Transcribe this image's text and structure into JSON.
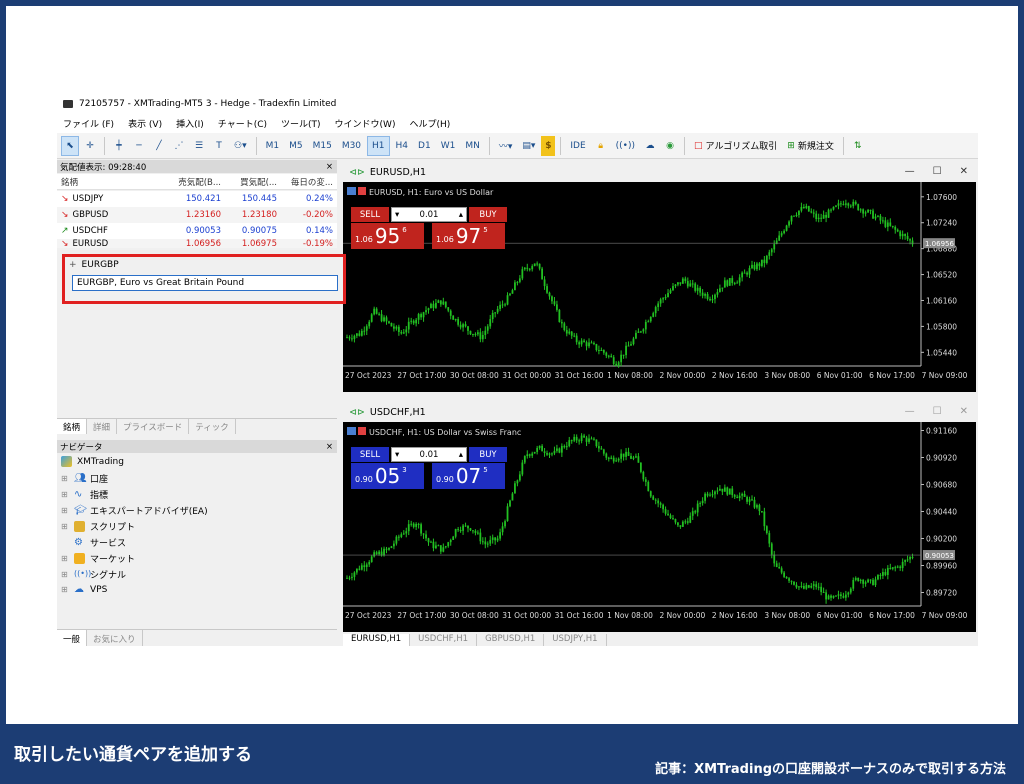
{
  "window": {
    "title": "72105757 - XMTrading-MT5 3 - Hedge - Tradexfin Limited"
  },
  "menu": [
    "ファイル (F)",
    "表示 (V)",
    "挿入(I)",
    "チャート(C)",
    "ツール(T)",
    "ウインドウ(W)",
    "ヘルプ(H)"
  ],
  "toolbar": {
    "timeframes": [
      "M1",
      "M5",
      "M15",
      "M30",
      "H1",
      "H4",
      "D1",
      "W1",
      "MN"
    ],
    "active_timeframe": "H1",
    "ide": "IDE",
    "algo": "アルゴリズム取引",
    "new_order": "新規注文"
  },
  "market_watch": {
    "header": "気配値表示: 09:28:40",
    "columns": [
      "銘柄",
      "売気配(B...",
      "買気配(...",
      "毎日の変..."
    ],
    "rows": [
      {
        "symbol": "USDJPY",
        "bid": "150.421",
        "ask": "150.445",
        "change": "0.24%",
        "dir": "down"
      },
      {
        "symbol": "GBPUSD",
        "bid": "1.23160",
        "ask": "1.23180",
        "change": "-0.20%",
        "dir": "down"
      },
      {
        "symbol": "USDCHF",
        "bid": "0.90053",
        "ask": "0.90075",
        "change": "0.14%",
        "dir": "up"
      },
      {
        "symbol": "EURUSD",
        "bid": "1.06956",
        "ask": "1.06975",
        "change": "-0.19%",
        "dir": "down"
      }
    ],
    "input_value": "EURGBP",
    "suggestion": "EURGBP, Euro vs Great Britain Pound",
    "tabs": [
      "銘柄",
      "詳細",
      "プライスボード",
      "ティック"
    ]
  },
  "navigator": {
    "header": "ナビゲータ",
    "root": "XMTrading",
    "items": [
      "口座",
      "指標",
      "エキスパートアドバイザ(EA)",
      "スクリプト",
      "サービス",
      "マーケット",
      "シグナル",
      "VPS"
    ],
    "tabs": [
      "一般",
      "お気に入り"
    ]
  },
  "charts": [
    {
      "window_title": "EURUSD,H1",
      "chart_title": "EURUSD, H1:  Euro vs US Dollar",
      "sell_label": "SELL",
      "buy_label": "BUY",
      "lot": "0.01",
      "sell_price": {
        "small": "1.06",
        "big": "95",
        "pip": "6"
      },
      "buy_price": {
        "small": "1.06",
        "big": "97",
        "pip": "5"
      },
      "button_color": "#c0241e",
      "current_price": "1.06956"
    },
    {
      "window_title": "USDCHF,H1",
      "chart_title": "USDCHF, H1:  US Dollar vs Swiss Franc",
      "sell_label": "SELL",
      "buy_label": "BUY",
      "lot": "0.01",
      "sell_price": {
        "small": "0.90",
        "big": "05",
        "pip": "3"
      },
      "buy_price": {
        "small": "0.90",
        "big": "07",
        "pip": "5"
      },
      "button_color": "#1f2ec2",
      "current_price": "0.90053"
    }
  ],
  "chart_data": [
    {
      "type": "candlestick",
      "series": "EURUSD H1",
      "y_ticks": [
        "1.07600",
        "1.07240",
        "1.06880",
        "1.06520",
        "1.06160",
        "1.05800",
        "1.05440"
      ],
      "ylim": [
        1.0525,
        1.0775
      ],
      "x_ticks": [
        "27 Oct 2023",
        "27 Oct 17:00",
        "30 Oct 08:00",
        "31 Oct 00:00",
        "31 Oct 16:00",
        "1 Nov 08:00",
        "2 Nov 00:00",
        "2 Nov 16:00",
        "3 Nov 08:00",
        "6 Nov 01:00",
        "6 Nov 17:00",
        "7 Nov 09:00"
      ],
      "close_path": [
        1.0565,
        1.057,
        1.06,
        1.0585,
        1.057,
        1.059,
        1.0605,
        1.0615,
        1.059,
        1.0575,
        1.0565,
        1.06,
        1.062,
        1.0655,
        1.067,
        1.0625,
        1.058,
        1.056,
        1.0555,
        1.0545,
        1.053,
        1.0555,
        1.058,
        1.061,
        1.063,
        1.0645,
        1.063,
        1.062,
        1.064,
        1.0645,
        1.066,
        1.067,
        1.07,
        1.0735,
        1.0745,
        1.0728,
        1.074,
        1.0755,
        1.0745,
        1.0735,
        1.0722,
        1.071,
        1.0696
      ]
    },
    {
      "type": "candlestick",
      "series": "USDCHF H1",
      "y_ticks": [
        "0.91160",
        "0.90920",
        "0.90680",
        "0.90440",
        "0.90200",
        "0.89960",
        "0.89720"
      ],
      "ylim": [
        0.896,
        0.912
      ],
      "x_ticks": [
        "27 Oct 2023",
        "27 Oct 17:00",
        "30 Oct 08:00",
        "31 Oct 00:00",
        "31 Oct 16:00",
        "1 Nov 08:00",
        "2 Nov 00:00",
        "2 Nov 16:00",
        "3 Nov 08:00",
        "6 Nov 01:00",
        "6 Nov 17:00",
        "7 Nov 09:00"
      ],
      "close_path": [
        0.8985,
        0.8995,
        0.9005,
        0.901,
        0.9025,
        0.9035,
        0.9015,
        0.901,
        0.903,
        0.903,
        0.9015,
        0.902,
        0.906,
        0.9095,
        0.91,
        0.9095,
        0.9105,
        0.911,
        0.9105,
        0.909,
        0.9095,
        0.909,
        0.906,
        0.9045,
        0.903,
        0.904,
        0.906,
        0.9065,
        0.906,
        0.9055,
        0.9045,
        0.8995,
        0.8985,
        0.8975,
        0.8978,
        0.8965,
        0.897,
        0.8985,
        0.898,
        0.899,
        0.8995,
        0.9005
      ]
    }
  ],
  "bottom_tabs": [
    "EURUSD,H1",
    "USDCHF,H1",
    "GBPUSD,H1",
    "USDJPY,H1"
  ],
  "caption": {
    "left": "取引したい通貨ペアを追加する",
    "right": "記事：XMTradingの口座開設ボーナスのみで取引する方法"
  },
  "colors": {
    "accent_red": "#e02020",
    "candle_green": "#22c122",
    "banner": "#1c3d74"
  }
}
